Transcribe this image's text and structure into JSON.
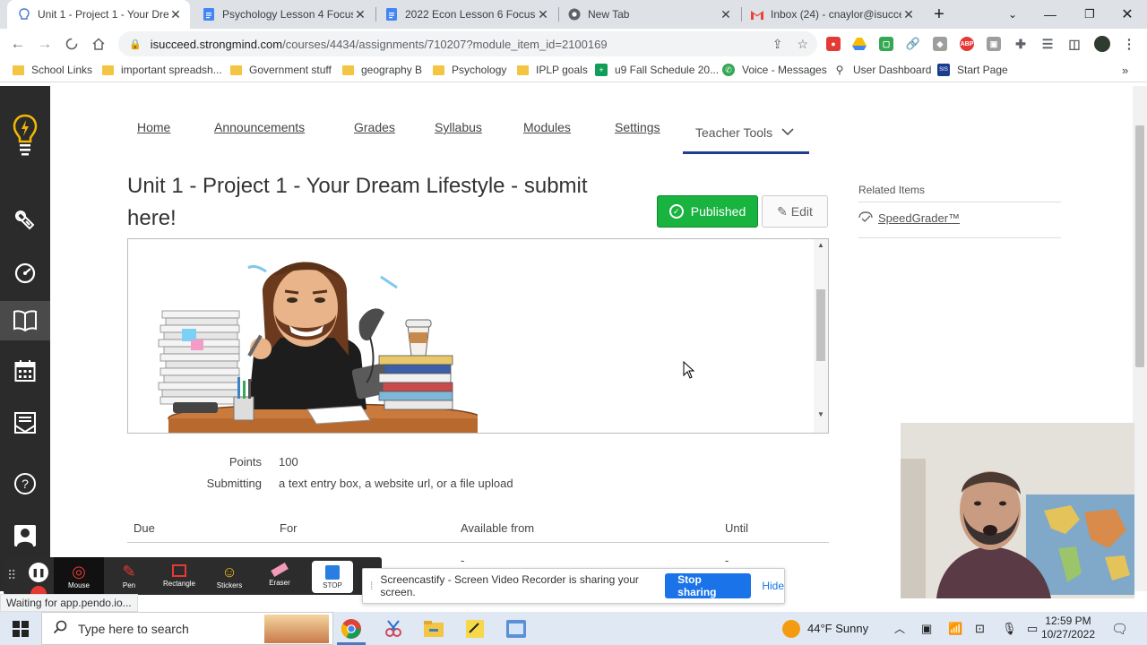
{
  "browser": {
    "tabs": [
      {
        "title": "Unit 1 - Project 1 - Your Drea",
        "active": true
      },
      {
        "title": "Psychology Lesson 4 Focuse"
      },
      {
        "title": "2022 Econ Lesson 6 Focused"
      },
      {
        "title": "New Tab"
      },
      {
        "title": "Inbox (24) - cnaylor@isucce"
      }
    ],
    "url_host": "isucceed.strongmind.com",
    "url_path": "/courses/4434/assignments/710207?module_item_id=2100169",
    "bookmarks": [
      "School Links",
      "important spreadsh...",
      "Government stuff",
      "geography B",
      "Psychology",
      "IPLP goals",
      "u9 Fall Schedule 20...",
      "Voice - Messages",
      "User Dashboard",
      "Start Page"
    ]
  },
  "course_nav": {
    "items": [
      "Home",
      "Announcements",
      "Grades",
      "Syllabus",
      "Modules",
      "Settings"
    ],
    "teacher_tools": "Teacher Tools"
  },
  "assignment": {
    "title": "Unit 1 - Project 1 - Your Dream Lifestyle - submit here!",
    "published_label": "Published",
    "edit_label": "Edit",
    "points_label": "Points",
    "points_value": "100",
    "submitting_label": "Submitting",
    "submitting_value": "a text entry box, a website url, or a file upload",
    "due_table": {
      "headers": [
        "Due",
        "For",
        "Available from",
        "Until"
      ],
      "row": [
        "",
        "",
        "-",
        "-"
      ]
    }
  },
  "related": {
    "heading": "Related Items",
    "speedgrader": "SpeedGrader™"
  },
  "screencastify": {
    "tools": [
      "Mouse",
      "Pen",
      "Rectangle",
      "Stickers",
      "Eraser",
      "STOP"
    ],
    "banner_text": "Screencastify - Screen Video Recorder is sharing your screen.",
    "stop_sharing": "Stop sharing",
    "hide": "Hide"
  },
  "status_text": "Waiting for app.pendo.io...",
  "taskbar": {
    "search_placeholder": "Type here to search",
    "weather": "44°F  Sunny",
    "time": "12:59 PM",
    "date": "10/27/2022"
  },
  "colors": {
    "published_green": "#19b33f",
    "teacher_tools_underline": "#1f3f8f",
    "leftnav_bg": "#2b2b2b",
    "stop_sharing_blue": "#1a73e8"
  }
}
